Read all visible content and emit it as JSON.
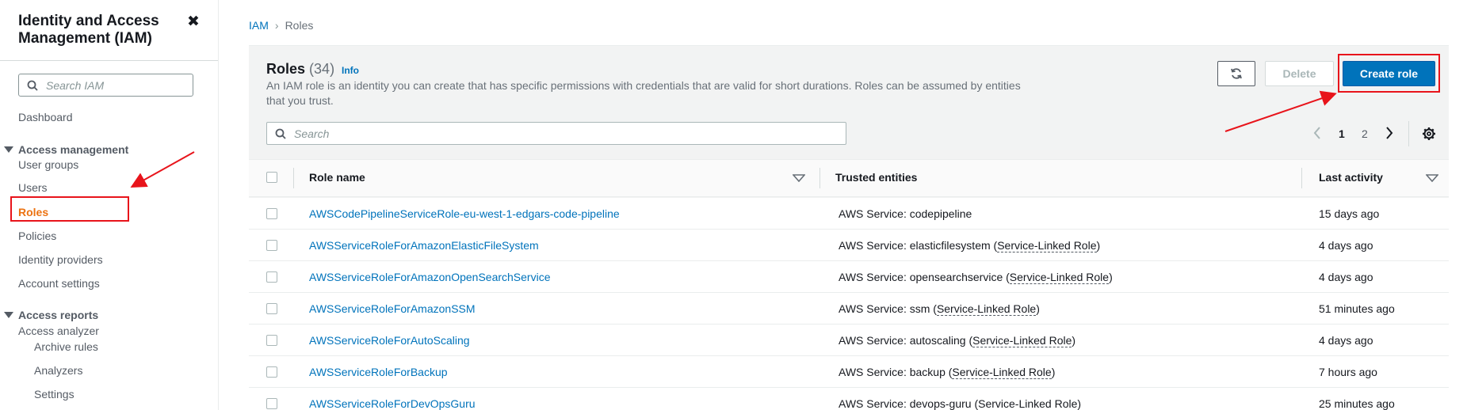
{
  "sidebar": {
    "title": "Identity and Access Management (IAM)",
    "close_icon": "close-icon",
    "search_placeholder": "Search IAM",
    "dashboard": "Dashboard",
    "access_management": {
      "label": "Access management",
      "items": [
        "User groups",
        "Users",
        "Roles",
        "Policies",
        "Identity providers",
        "Account settings"
      ]
    },
    "access_reports": {
      "label": "Access reports",
      "items": [
        "Access analyzer"
      ],
      "sub_items": [
        "Archive rules",
        "Analyzers",
        "Settings"
      ]
    },
    "active_item": "Roles",
    "active_color": "#ec7211"
  },
  "breadcrumb": {
    "root": "IAM",
    "current": "Roles"
  },
  "roles_panel": {
    "title": "Roles",
    "count": "(34)",
    "info": "Info",
    "description": "An IAM role is an identity you can create that has specific permissions with credentials that are valid for short durations. Roles can be assumed by entities that you trust.",
    "refresh_icon": "refresh-icon",
    "delete_label": "Delete",
    "create_label": "Create role",
    "search_placeholder": "Search",
    "pagination": {
      "pages": [
        "1",
        "2"
      ],
      "current": "1"
    },
    "settings_icon": "gear-icon"
  },
  "table": {
    "columns": [
      "Role name",
      "Trusted entities",
      "Last activity"
    ],
    "rows": [
      {
        "name": "AWSCodePipelineServiceRole-eu-west-1-edgars-code-pipeline",
        "trust_prefix": "AWS Service: codepipeline",
        "trust_link": "",
        "trust_suffix": "",
        "activity": "15 days ago"
      },
      {
        "name": "AWSServiceRoleForAmazonElasticFileSystem",
        "trust_prefix": "AWS Service: elasticfilesystem (",
        "trust_link": "Service-Linked Role",
        "trust_suffix": ")",
        "activity": "4 days ago"
      },
      {
        "name": "AWSServiceRoleForAmazonOpenSearchService",
        "trust_prefix": "AWS Service: opensearchservice (",
        "trust_link": "Service-Linked Role",
        "trust_suffix": ")",
        "activity": "4 days ago"
      },
      {
        "name": "AWSServiceRoleForAmazonSSM",
        "trust_prefix": "AWS Service: ssm (",
        "trust_link": "Service-Linked Role",
        "trust_suffix": ")",
        "activity": "51 minutes ago"
      },
      {
        "name": "AWSServiceRoleForAutoScaling",
        "trust_prefix": "AWS Service: autoscaling (",
        "trust_link": "Service-Linked Role",
        "trust_suffix": ")",
        "activity": "4 days ago"
      },
      {
        "name": "AWSServiceRoleForBackup",
        "trust_prefix": "AWS Service: backup (",
        "trust_link": "Service-Linked Role",
        "trust_suffix": ")",
        "activity": "7 hours ago"
      },
      {
        "name": "AWSServiceRoleForDevOpsGuru",
        "trust_prefix": "AWS Service: devops-guru (Service-Linked Role)",
        "trust_link": "",
        "trust_suffix": "",
        "activity": "25 minutes ago"
      }
    ]
  },
  "colors": {
    "link": "#0073bb",
    "primary_button": "#0073bb",
    "annotation": "#e8141b"
  }
}
